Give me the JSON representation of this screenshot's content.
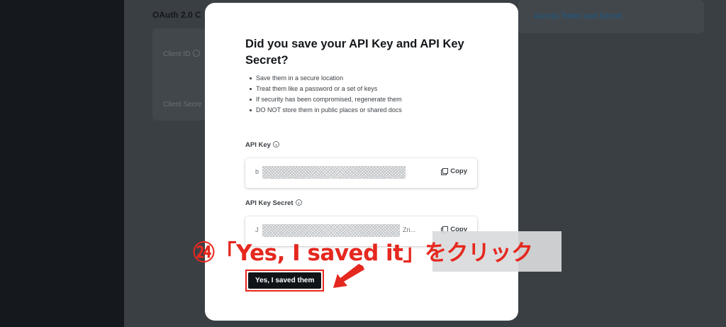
{
  "background": {
    "section_title": "OAuth 2.0 C",
    "client_id_label": "Client ID",
    "client_secret_label": "Client Secre",
    "access_token_link": "Access Token and Secret"
  },
  "modal": {
    "title": "Did you save your API Key and API Key Secret?",
    "bullets": [
      "Save them in a secure location",
      "Treat them like a password or a set of keys",
      "If security has been compromised, regenerate them",
      "DO NOT store them in public places or shared docs"
    ],
    "api_key": {
      "label": "API Key",
      "value_prefix": "b",
      "copy_label": "Copy"
    },
    "api_key_secret": {
      "label": "API Key Secret",
      "value_prefix": "J",
      "value_suffix": "Zn...",
      "copy_label": "Copy"
    },
    "confirm_button": "Yes, I saved them"
  },
  "annotation": {
    "text": "㉔「Yes, I saved it」をクリック",
    "color": "#e5281f"
  },
  "colors": {
    "overlay": "#3a3f44",
    "sidebar": "#15191d",
    "button_dark": "#0f1419",
    "annotation_red": "#e5281f"
  }
}
